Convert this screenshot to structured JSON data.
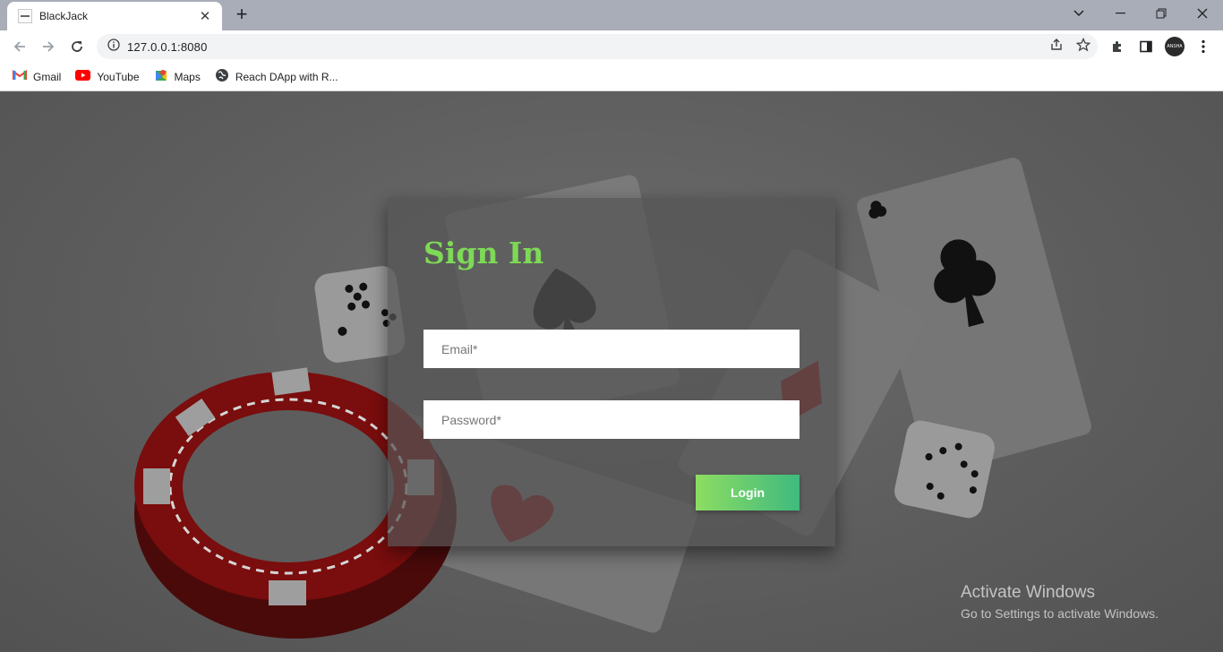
{
  "browser": {
    "tab_title": "BlackJack",
    "url": "127.0.0.1:8080",
    "avatar_label": "ANSHA",
    "bookmarks": [
      {
        "label": "Gmail",
        "icon": "gmail-icon"
      },
      {
        "label": "YouTube",
        "icon": "youtube-icon"
      },
      {
        "label": "Maps",
        "icon": "maps-icon"
      },
      {
        "label": "Reach DApp with R...",
        "icon": "globe-icon"
      }
    ]
  },
  "signin": {
    "title": "Sign In",
    "email_placeholder": "Email*",
    "password_placeholder": "Password*",
    "login_label": "Login"
  },
  "watermark": {
    "line1": "Activate Windows",
    "line2": "Go to Settings to activate Windows."
  },
  "colors": {
    "title": "#7ed957",
    "button_start": "#8ddd61",
    "button_end": "#3fba7f",
    "background": "#5e5e5e"
  }
}
